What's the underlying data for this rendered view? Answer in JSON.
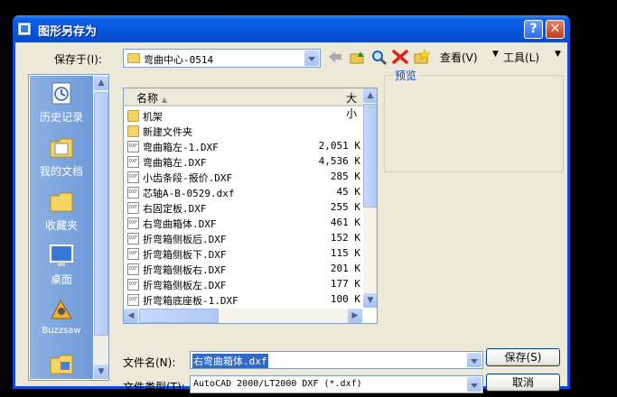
{
  "window": {
    "title": "图形另存为",
    "help": "?",
    "close": "✕"
  },
  "save_in": {
    "label": "保存于(I):",
    "value": "弯曲中心-0514"
  },
  "toolbar": {
    "views_label": "查看(V)",
    "tools_label": "工具(L)"
  },
  "places": [
    "历史记录",
    "我的文档",
    "收藏夹",
    "桌面",
    "Buzzsaw"
  ],
  "list": {
    "col_name": "名称",
    "col_size": "大小",
    "items": [
      {
        "name": "机架",
        "size": "",
        "type": "folder"
      },
      {
        "name": "新建文件夹",
        "size": "",
        "type": "folder"
      },
      {
        "name": "弯曲箱左-1.DXF",
        "size": "2,051 K",
        "type": "dxf"
      },
      {
        "name": "弯曲箱左.DXF",
        "size": "4,536 K",
        "type": "dxf"
      },
      {
        "name": "小齿条段-报价.DXF",
        "size": "285 K",
        "type": "dxf"
      },
      {
        "name": "芯轴A-B-0529.dxf",
        "size": "45 K",
        "type": "dxf"
      },
      {
        "name": "右固定板.DXF",
        "size": "255 K",
        "type": "dxf"
      },
      {
        "name": "右弯曲箱体.DXF",
        "size": "461 K",
        "type": "dxf"
      },
      {
        "name": "折弯箱侧板后.DXF",
        "size": "152 K",
        "type": "dxf"
      },
      {
        "name": "折弯箱侧板下.DXF",
        "size": "115 K",
        "type": "dxf"
      },
      {
        "name": "折弯箱侧板右.DXF",
        "size": "201 K",
        "type": "dxf"
      },
      {
        "name": "折弯箱侧板左.DXF",
        "size": "177 K",
        "type": "dxf"
      },
      {
        "name": "折弯箱底座板-1.DXF",
        "size": "100 K",
        "type": "dxf"
      }
    ]
  },
  "preview": {
    "label": "预览"
  },
  "filename": {
    "label": "文件名(N):",
    "value": "右弯曲箱体.dxf"
  },
  "filetype": {
    "label": "文件类型(T):",
    "value": "AutoCAD 2000/LT2000 DXF (*.dxf)"
  },
  "buttons": {
    "save": "保存(S)",
    "cancel": "取消"
  },
  "colors": {
    "title_bar": "#0855dd",
    "client_bg": "#ece9d8",
    "places_bar": "#7aa3dc",
    "selection": "#316ac5"
  }
}
